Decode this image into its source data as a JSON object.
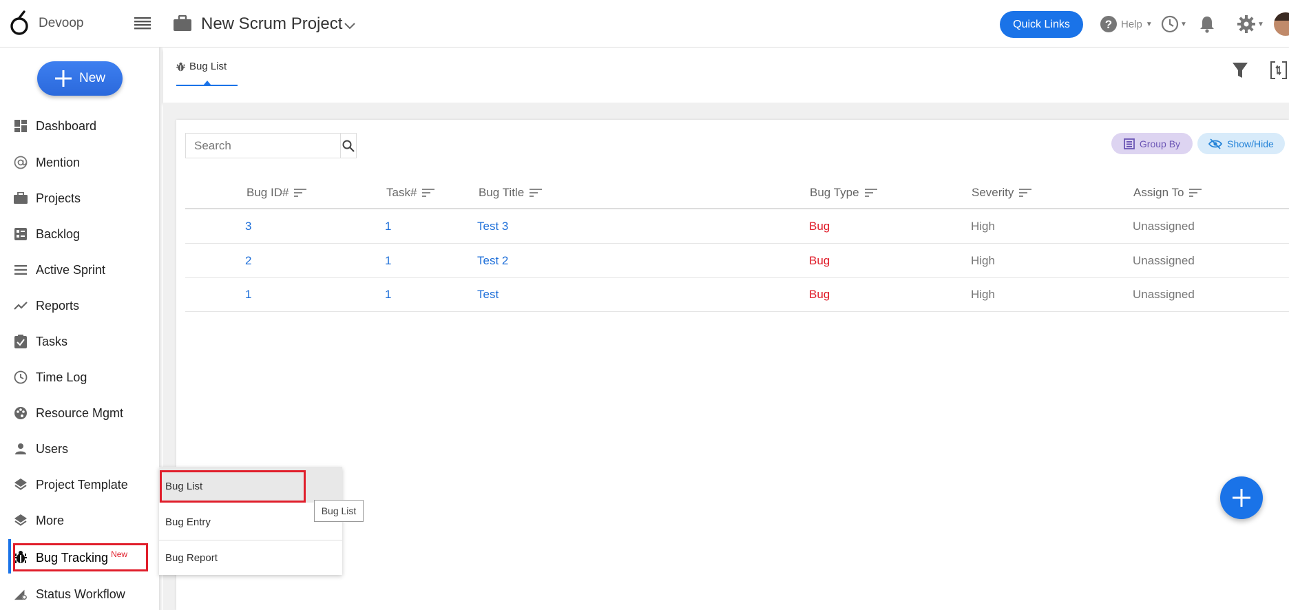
{
  "app": {
    "brand": "Devoop"
  },
  "header": {
    "project_title": "New Scrum Project",
    "quick_links": "Quick Links",
    "help": "Help"
  },
  "sidebar": {
    "new_button": "New",
    "items": [
      {
        "label": "Dashboard",
        "icon": "dashboard-icon"
      },
      {
        "label": "Mention",
        "icon": "at-icon"
      },
      {
        "label": "Projects",
        "icon": "briefcase-icon"
      },
      {
        "label": "Backlog",
        "icon": "backlog-icon"
      },
      {
        "label": "Active Sprint",
        "icon": "list-icon"
      },
      {
        "label": "Reports",
        "icon": "trend-icon"
      },
      {
        "label": "Tasks",
        "icon": "clipboard-icon"
      },
      {
        "label": "Time Log",
        "icon": "clock-icon"
      },
      {
        "label": "Resource Mgmt",
        "icon": "palette-icon"
      },
      {
        "label": "Users",
        "icon": "user-icon"
      },
      {
        "label": "Project Template",
        "icon": "layers-icon"
      },
      {
        "label": "More",
        "icon": "layers-icon"
      },
      {
        "label": "Bug Tracking",
        "icon": "bug-icon",
        "badge": "New",
        "active": true
      },
      {
        "label": "Status Workflow",
        "icon": "workflow-icon"
      }
    ]
  },
  "tab": {
    "label": "Bug List"
  },
  "toolbar": {
    "search_placeholder": "Search",
    "group_by": "Group By",
    "show_hide": "Show/Hide"
  },
  "table": {
    "columns": [
      "Bug ID#",
      "Task#",
      "Bug Title",
      "Bug Type",
      "Severity",
      "Assign To"
    ],
    "rows": [
      {
        "bug_id": "3",
        "task": "1",
        "title": "Test 3",
        "type": "Bug",
        "severity": "High",
        "assign": "Unassigned"
      },
      {
        "bug_id": "2",
        "task": "1",
        "title": "Test 2",
        "type": "Bug",
        "severity": "High",
        "assign": "Unassigned"
      },
      {
        "bug_id": "1",
        "task": "1",
        "title": "Test",
        "type": "Bug",
        "severity": "High",
        "assign": "Unassigned"
      }
    ]
  },
  "submenu": {
    "items": [
      "Bug List",
      "Bug Entry",
      "Bug Report"
    ],
    "tooltip": "Bug List"
  },
  "colors": {
    "primary": "#1a73e8",
    "highlight_red": "#e01e2b",
    "link_blue": "#1e6fd9"
  }
}
